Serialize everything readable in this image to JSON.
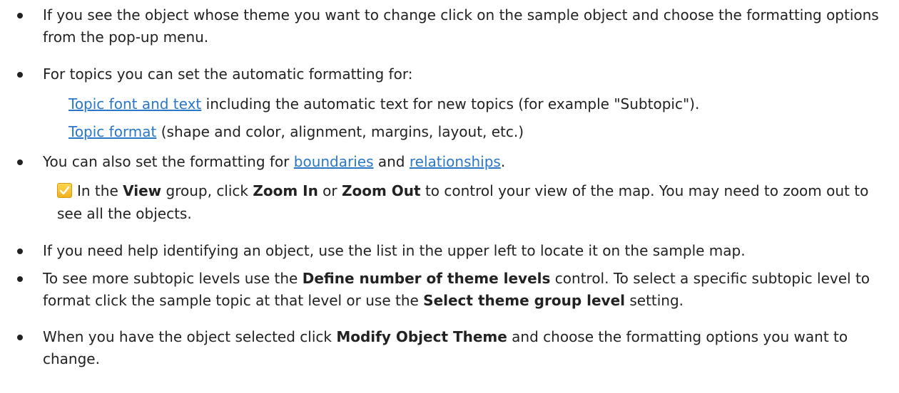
{
  "bullets": {
    "b1": {
      "text": "If you see the object whose theme you want to change click on the sample object and choose the formatting options from the pop-up menu."
    },
    "b2": {
      "text": "For topics you can set the automatic formatting for:",
      "sub1_link": "Topic font and text",
      "sub1_rest": " including the automatic text for new topics (for example \"Subtopic\").",
      "sub2_link": "Topic format",
      "sub2_rest": " (shape and color, alignment, margins, layout, etc.)"
    },
    "b3": {
      "pre": "You can also set the formatting for ",
      "link1": "boundaries",
      "mid": " and ",
      "link2": "relationships",
      "post": "."
    },
    "tip": {
      "t1": "In the ",
      "view": "View",
      "t2": " group, click ",
      "zoom_in": "Zoom In",
      "t3": " or ",
      "zoom_out": "Zoom Out",
      "t4": " to control your view of the map. You may need to zoom out to see all the objects.",
      "icon": "checkbox-checked-icon"
    },
    "b4": {
      "text": "If you need help identifying an object, use the list in the upper left to locate it on the sample map."
    },
    "b5": {
      "t1": "To see more subtopic levels use the ",
      "b_define": "Define number of theme levels",
      "t2": " control. To select a specific subtopic level to format click the sample topic at that level or use the ",
      "b_select": "Select theme group level",
      "t3": " setting."
    },
    "b6": {
      "t1": "When you have the object selected click ",
      "b_modify": "Modify Object Theme",
      "t2": " and choose the formatting options you want to change."
    }
  },
  "colors": {
    "link": "#2a77c8",
    "text": "#222222",
    "tip_icon": "#f2b01e"
  }
}
